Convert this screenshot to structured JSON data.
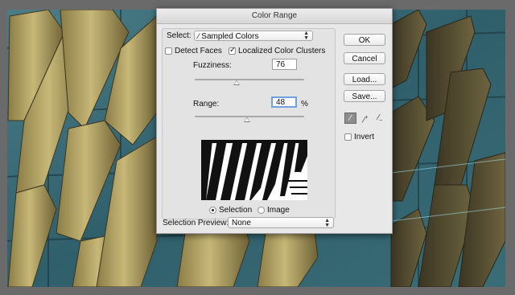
{
  "dialog": {
    "title": "Color Range",
    "select_label": "Select:",
    "select_value": "Sampled Colors",
    "detect_faces": {
      "label": "Detect Faces",
      "checked": false
    },
    "localized_clusters": {
      "label": "Localized Color Clusters",
      "checked": true
    },
    "fuzziness": {
      "label": "Fuzziness:",
      "value": "76",
      "slider_fraction": 0.38
    },
    "range": {
      "label": "Range:",
      "value": "48",
      "unit": "%",
      "slider_fraction": 0.48
    },
    "view_options": {
      "selection_label": "Selection",
      "image_label": "Image",
      "selected": "Selection"
    },
    "preview_label": "Selection Preview:",
    "preview_value": "None",
    "buttons": {
      "ok": "OK",
      "cancel": "Cancel",
      "load": "Load...",
      "save": "Save..."
    },
    "invert": {
      "label": "Invert",
      "checked": false
    },
    "eyedroppers": [
      "eyedropper-icon",
      "eyedropper-plus-icon",
      "eyedropper-minus-icon"
    ]
  },
  "colors": {
    "focus_ring": "#6fa3e0",
    "background_teal": "#3d6f7a",
    "background_gold": "#b9a967"
  }
}
